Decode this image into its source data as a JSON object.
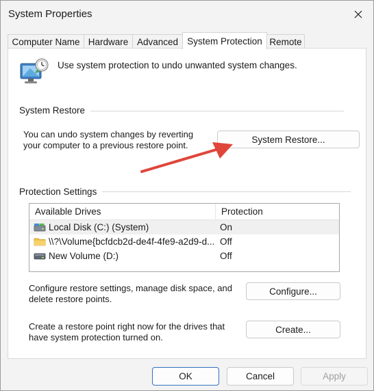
{
  "window": {
    "title": "System Properties"
  },
  "tabs": [
    {
      "label": "Computer Name"
    },
    {
      "label": "Hardware"
    },
    {
      "label": "Advanced"
    },
    {
      "label": "System Protection",
      "active": true
    },
    {
      "label": "Remote"
    }
  ],
  "intro": {
    "text": "Use system protection to undo unwanted system changes."
  },
  "system_restore": {
    "group_title": "System Restore",
    "description_line1": "You can undo system changes by reverting",
    "description_line2": "your computer to a previous restore point.",
    "button_label": "System Restore..."
  },
  "protection_settings": {
    "group_title": "Protection Settings",
    "columns": [
      "Available Drives",
      "Protection"
    ],
    "drives": [
      {
        "name": "Local Disk (C:) (System)",
        "protection": "On",
        "icon": "system-drive-icon"
      },
      {
        "name": "\\\\?\\Volume{bcfdcb2d-de4f-4fe9-a2d9-d...",
        "protection": "Off",
        "icon": "folder-icon"
      },
      {
        "name": "New Volume (D:)",
        "protection": "Off",
        "icon": "drive-icon"
      }
    ],
    "configure_desc_line1": "Configure restore settings, manage disk space, and",
    "configure_desc_line2": "delete restore points.",
    "configure_label": "Configure...",
    "create_desc_line1": "Create a restore point right now for the drives that",
    "create_desc_line2": "have system protection turned on.",
    "create_label": "Create..."
  },
  "footer": {
    "ok_label": "OK",
    "cancel_label": "Cancel",
    "apply_label": "Apply"
  },
  "colors": {
    "annotation_arrow": "#e0453a",
    "accent_border": "#2f6fbf"
  }
}
